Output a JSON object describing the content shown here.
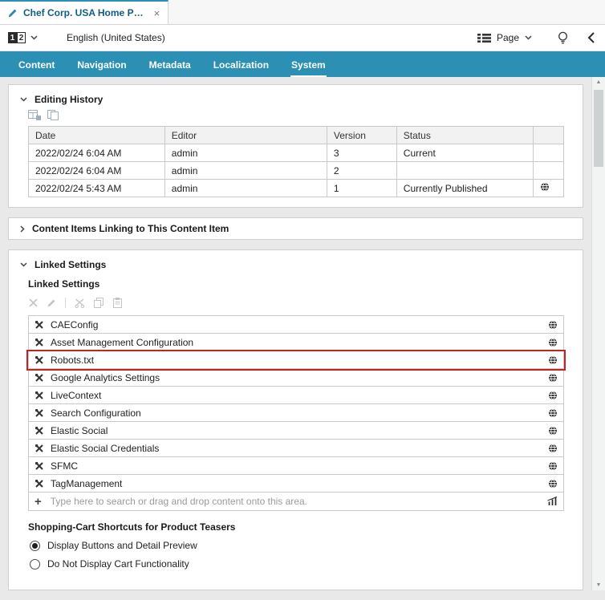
{
  "window_tab": {
    "title": "Chef Corp. USA Home P…",
    "close_glyph": "×"
  },
  "toolbar": {
    "site_badge": {
      "digit1": "1",
      "digit2": "2"
    },
    "locale": "English (United States)",
    "page_menu_label": "Page"
  },
  "nav_tabs": {
    "items": [
      "Content",
      "Navigation",
      "Metadata",
      "Localization",
      "System"
    ],
    "active": "System"
  },
  "editing_history": {
    "title": "Editing History",
    "columns": [
      "Date",
      "Editor",
      "Version",
      "Status"
    ],
    "rows": [
      {
        "date": "2022/02/24 6:04 AM",
        "editor": "admin",
        "version": "3",
        "status": "Current"
      },
      {
        "date": "2022/02/24 6:04 AM",
        "editor": "admin",
        "version": "2",
        "status": ""
      },
      {
        "date": "2022/02/24 5:43 AM",
        "editor": "admin",
        "version": "1",
        "status": "Currently Published"
      }
    ]
  },
  "linking_section": {
    "title": "Content Items Linking to This Content Item"
  },
  "linked_settings": {
    "title": "Linked Settings",
    "subtitle": "Linked Settings",
    "items": [
      "CAEConfig",
      "Asset Management Configuration",
      "Robots.txt",
      "Google Analytics Settings",
      "LiveContext",
      "Search Configuration",
      "Elastic Social",
      "Elastic Social Credentials",
      "SFMC",
      "TagManagement"
    ],
    "highlighted_item": "Robots.txt",
    "highlight_color": "#c32323",
    "input_placeholder": "Type here to search or drag and drop content onto this area.",
    "plus_glyph": "+"
  },
  "shopping_cart": {
    "title": "Shopping-Cart Shortcuts for Product Teasers",
    "options": [
      {
        "label": "Display Buttons and Detail Preview",
        "selected": true
      },
      {
        "label": "Do Not Display Cart Functionality",
        "selected": false
      }
    ]
  },
  "colors": {
    "accent_teal": "#2b90b4",
    "highlight_red": "#c32323"
  }
}
